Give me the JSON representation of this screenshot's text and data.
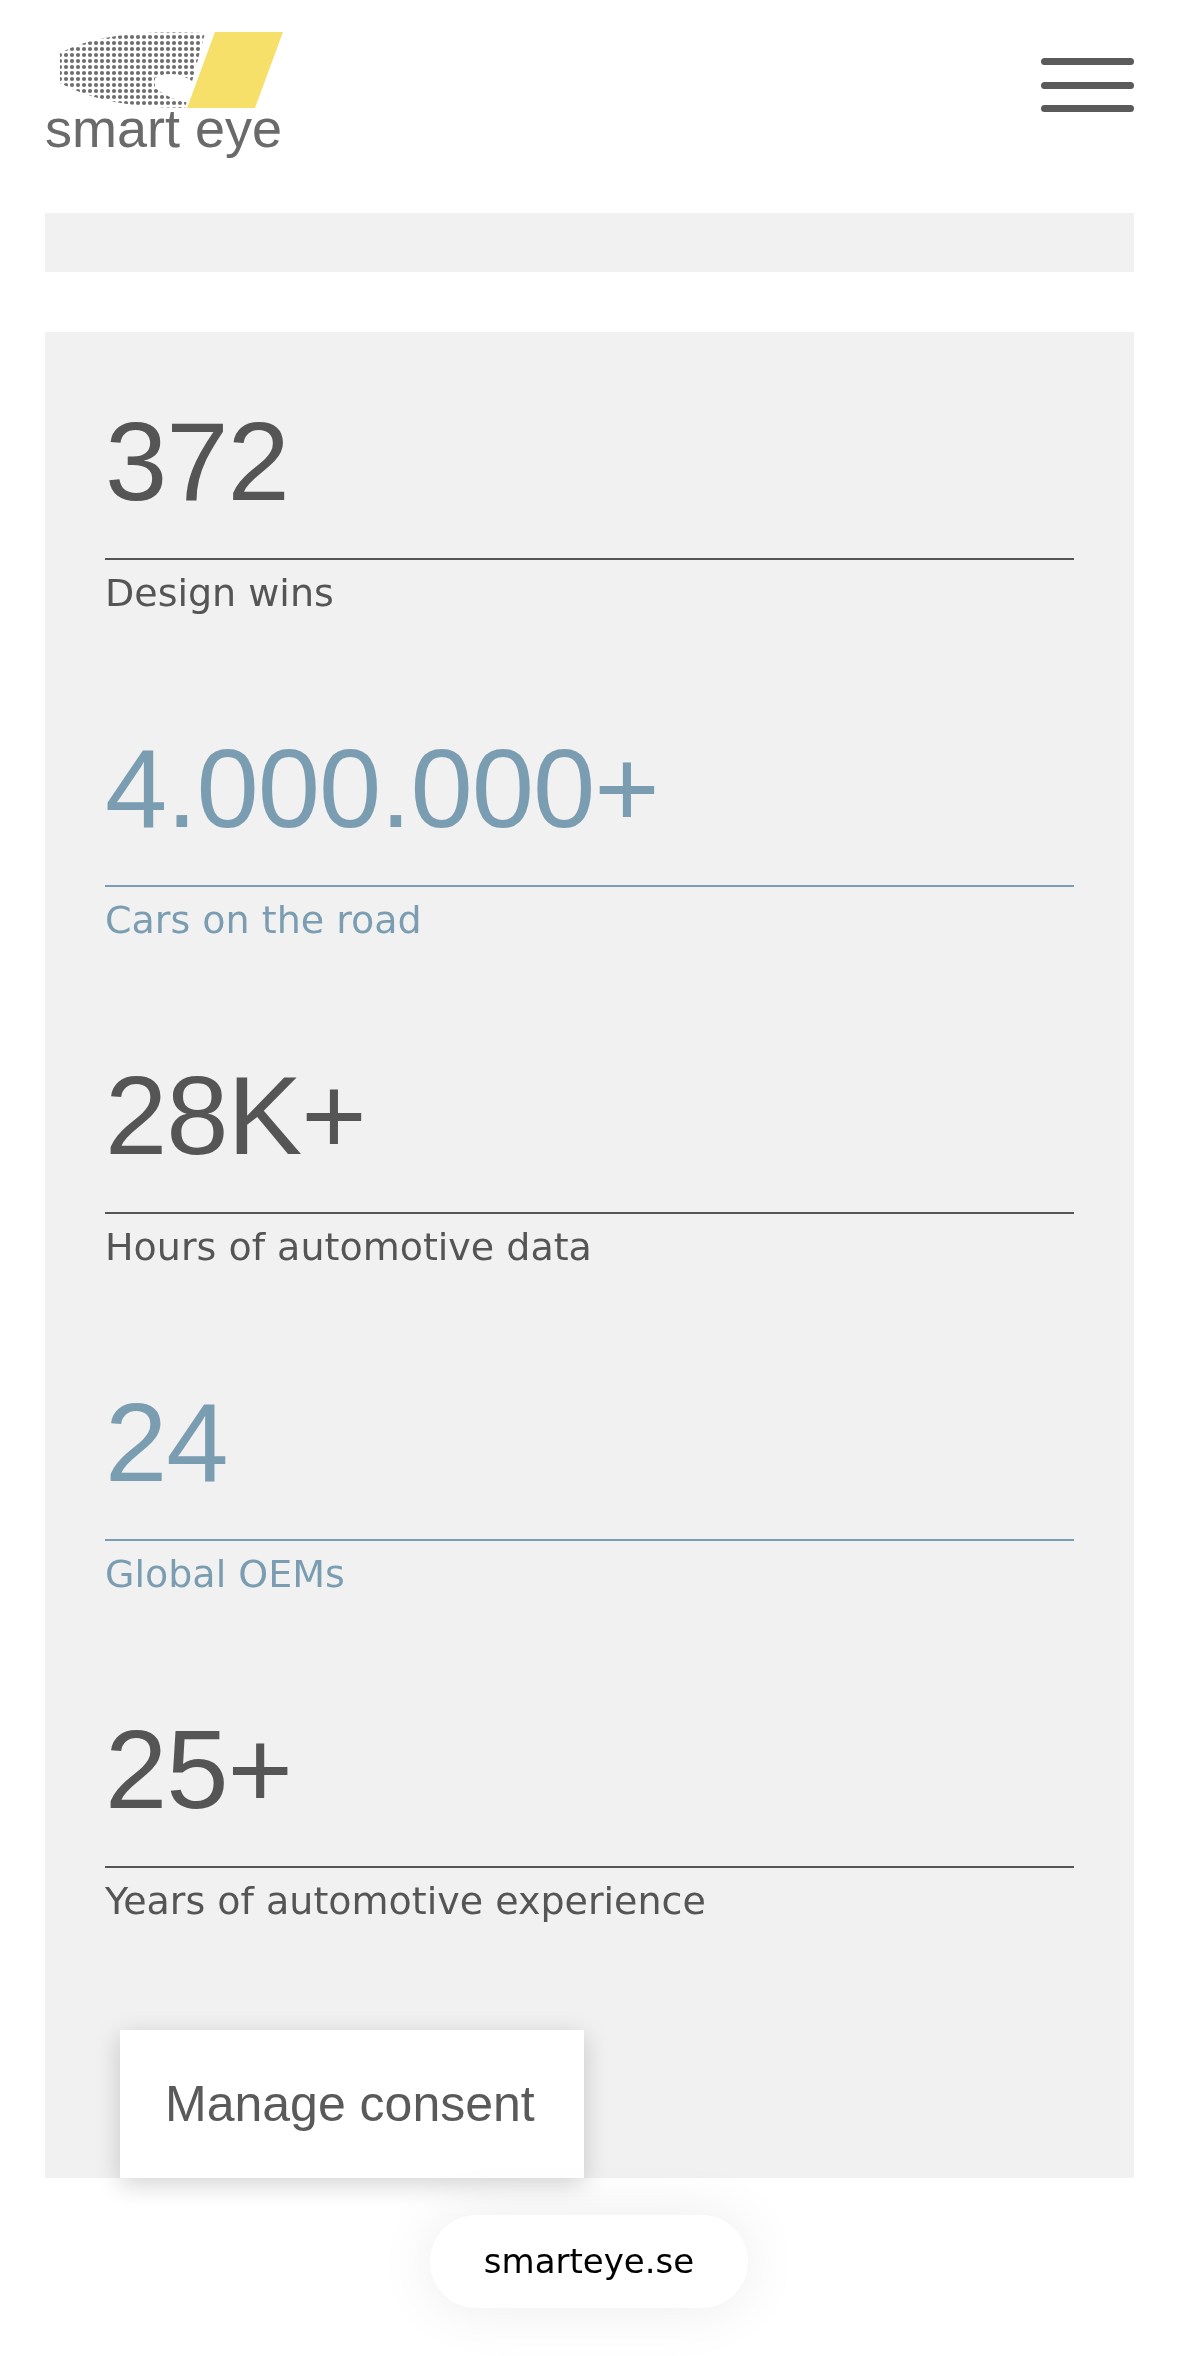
{
  "header": {
    "logo_text": "smart eye"
  },
  "stats": [
    {
      "value": "372",
      "label": "Design wins",
      "color": "#555555"
    },
    {
      "value": "4.000.000+",
      "label": "Cars on the road",
      "color": "#7b9db2"
    },
    {
      "value": "28K+",
      "label": "Hours of automotive data",
      "color": "#555555"
    },
    {
      "value": "24",
      "label": "Global OEMs",
      "color": "#7b9db2"
    },
    {
      "value": "25+",
      "label": "Years of automotive experience",
      "color": "#555555"
    }
  ],
  "consent_button": "Manage consent",
  "url_pill": "smarteye.se"
}
